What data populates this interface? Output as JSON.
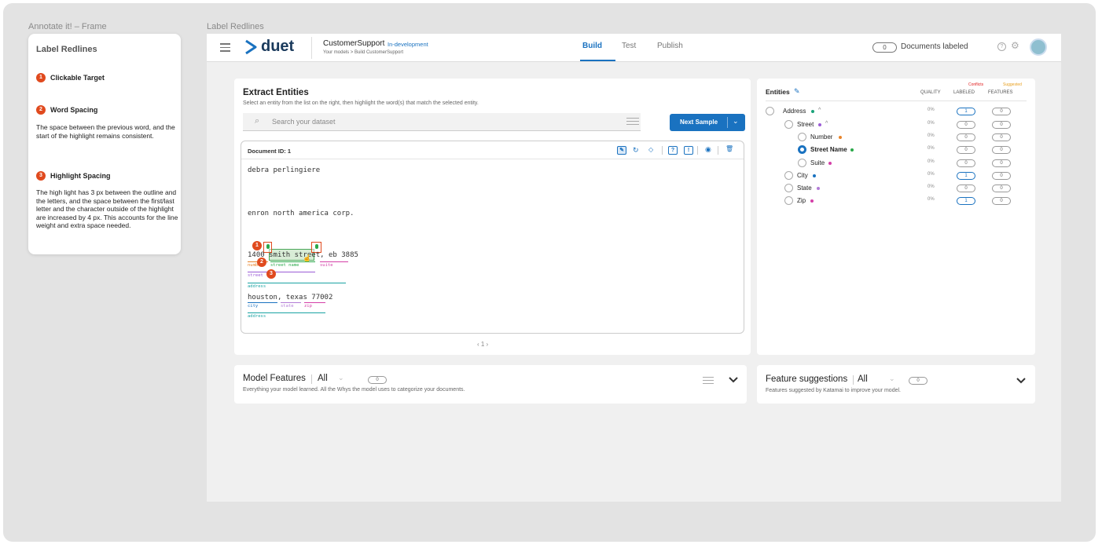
{
  "frames": {
    "left_title": "Annotate it! – Frame",
    "right_title": "Label Redlines"
  },
  "redlines": {
    "title": "Label Redlines",
    "items": [
      {
        "num": "1",
        "title": "Clickable Target",
        "desc": ""
      },
      {
        "num": "2",
        "title": "Word Spacing",
        "desc": "The space between the previous word, and the start of the highlight remains consistent."
      },
      {
        "num": "3",
        "title": "Highlight Spacing",
        "desc": "The high light has 3 px between the outline and the letters, and the space between the first/last letter and the character outside of the highlight are increased by 4 px. This accounts for the line weight and extra space needed."
      }
    ]
  },
  "header": {
    "logo": "duet",
    "model_name": "CustomerSupport",
    "model_status": "In-development",
    "breadcrumb": "Your models > Build CustomerSupport",
    "tabs": [
      "Build",
      "Test",
      "Publish"
    ],
    "active_tab": "Build",
    "docs_count": "0",
    "docs_label": "Documents labeled"
  },
  "extract": {
    "title": "Extract Entities",
    "subtitle": "Select an entity from the list on the right, then highlight the word(s) that match the selected entity.",
    "search_placeholder": "Search your dataset",
    "next_label": "Next Sample",
    "doc_id": "Document ID: 1",
    "toolbar_q": "?",
    "toolbar_ex": "!",
    "lines": {
      "l1": "debra perlingiere",
      "l2": "enron north america corp.",
      "l3_a": "1400",
      "l3_b": "smith street",
      "l3_c": ", eb 3885",
      "l4_a": "houston",
      "l4_b": ", texas ",
      "l4_c": "77002"
    },
    "tags": {
      "number": "number",
      "street_name": "street name",
      "suite": "suite",
      "street": "street",
      "address": "address",
      "city": "city",
      "state": "state",
      "zip": "zip"
    },
    "pager": "‹ 1 ›"
  },
  "entities": {
    "title": "Entities",
    "conflicts": "Conflicts",
    "suggested": "Suggested",
    "col_quality": "QUALITY",
    "col_labeled": "LABELED",
    "col_features": "FEATURES",
    "rows": [
      {
        "name": "Address",
        "color": "#1aa37a",
        "quality": "0%",
        "labeled": "1",
        "features": "0",
        "caret": "^"
      },
      {
        "name": "Street",
        "color": "#9b5cd6",
        "quality": "0%",
        "labeled": "0",
        "features": "0",
        "caret": "^"
      },
      {
        "name": "Number",
        "color": "#e8842a",
        "quality": "0%",
        "labeled": "0",
        "features": "0",
        "caret": ""
      },
      {
        "name": "Street Name",
        "color": "#2aa84a",
        "quality": "0%",
        "labeled": "0",
        "features": "0",
        "caret": ""
      },
      {
        "name": "Suite",
        "color": "#d43fa8",
        "quality": "0%",
        "labeled": "0",
        "features": "0",
        "caret": ""
      },
      {
        "name": "City",
        "color": "#1a72c0",
        "quality": "0%",
        "labeled": "1",
        "features": "0",
        "caret": ""
      },
      {
        "name": "State",
        "color": "#b27cd6",
        "quality": "0%",
        "labeled": "0",
        "features": "0",
        "caret": ""
      },
      {
        "name": "Zip",
        "color": "#d43fa8",
        "quality": "0%",
        "labeled": "1",
        "features": "0",
        "caret": ""
      }
    ]
  },
  "model_features": {
    "title": "Model Features",
    "filter": "All",
    "count": "0",
    "subtitle": "Everything your model learned. All the Whys the model uses to categorize your documents."
  },
  "feature_suggestions": {
    "title": "Feature suggestions",
    "filter": "All",
    "count": "0",
    "subtitle": "Features suggested by Katamai to improve your model."
  },
  "colors": {
    "accent": "#1a72c0",
    "badge": "#e04a1e"
  }
}
